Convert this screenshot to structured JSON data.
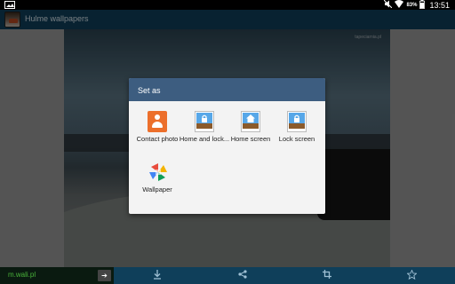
{
  "status_bar": {
    "battery_percent": "83%",
    "time": "13:51",
    "icons": [
      "image-notification-icon",
      "mute-icon",
      "wifi-icon",
      "battery-icon"
    ]
  },
  "app_bar": {
    "title": "Hulme wallpapers"
  },
  "photo": {
    "watermark": "tapeciarnia.pl"
  },
  "dialog": {
    "title": "Set as",
    "options": [
      {
        "label": "Contact photo",
        "icon": "contact-photo-icon"
      },
      {
        "label": "Home and lock...",
        "icon": "home-and-lock-icon"
      },
      {
        "label": "Home screen",
        "icon": "home-screen-icon"
      },
      {
        "label": "Lock screen",
        "icon": "lock-screen-icon"
      },
      {
        "label": "Wallpaper",
        "icon": "wallpaper-gallery-icon"
      }
    ]
  },
  "bottom_bar": {
    "ad_text": "m.wali.pl",
    "ad_button": "➔",
    "actions": [
      "download-icon",
      "share-icon",
      "crop-icon",
      "favorite-star-icon"
    ]
  },
  "colors": {
    "app_bar": "#0f3f5a",
    "dialog_header": "#3d5d80",
    "contact_accent": "#ec6f2b"
  }
}
